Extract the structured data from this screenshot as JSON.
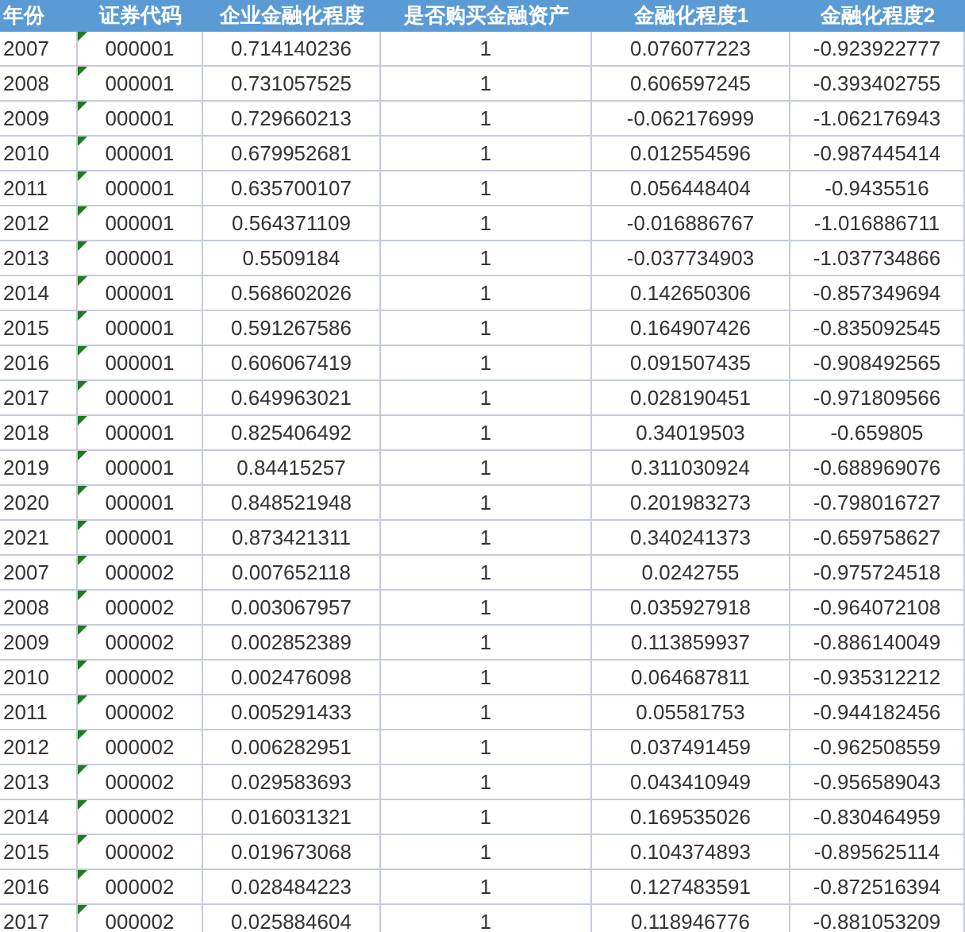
{
  "table": {
    "columns": [
      "年份",
      "证券代码",
      "企业金融化程度",
      "是否购买金融资产",
      "金融化程度1",
      "金融化程度2"
    ],
    "rows": [
      {
        "cells": [
          "2007",
          "000001",
          "0.714140236",
          "1",
          "0.076077223",
          "-0.923922777"
        ],
        "flagged": true
      },
      {
        "cells": [
          "2008",
          "000001",
          "0.731057525",
          "1",
          "0.606597245",
          "-0.393402755"
        ],
        "flagged": true
      },
      {
        "cells": [
          "2009",
          "000001",
          "0.729660213",
          "1",
          "-0.062176999",
          "-1.062176943"
        ],
        "flagged": true
      },
      {
        "cells": [
          "2010",
          "000001",
          "0.679952681",
          "1",
          "0.012554596",
          "-0.987445414"
        ],
        "flagged": true
      },
      {
        "cells": [
          "2011",
          "000001",
          "0.635700107",
          "1",
          "0.056448404",
          "-0.9435516"
        ],
        "flagged": true
      },
      {
        "cells": [
          "2012",
          "000001",
          "0.564371109",
          "1",
          "-0.016886767",
          "-1.016886711"
        ],
        "flagged": true
      },
      {
        "cells": [
          "2013",
          "000001",
          "0.5509184",
          "1",
          "-0.037734903",
          "-1.037734866"
        ],
        "flagged": true
      },
      {
        "cells": [
          "2014",
          "000001",
          "0.568602026",
          "1",
          "0.142650306",
          "-0.857349694"
        ],
        "flagged": true
      },
      {
        "cells": [
          "2015",
          "000001",
          "0.591267586",
          "1",
          "0.164907426",
          "-0.835092545"
        ],
        "flagged": true
      },
      {
        "cells": [
          "2016",
          "000001",
          "0.606067419",
          "1",
          "0.091507435",
          "-0.908492565"
        ],
        "flagged": true
      },
      {
        "cells": [
          "2017",
          "000001",
          "0.649963021",
          "1",
          "0.028190451",
          "-0.971809566"
        ],
        "flagged": true
      },
      {
        "cells": [
          "2018",
          "000001",
          "0.825406492",
          "1",
          "0.34019503",
          "-0.659805"
        ],
        "flagged": true
      },
      {
        "cells": [
          "2019",
          "000001",
          "0.84415257",
          "1",
          "0.311030924",
          "-0.688969076"
        ],
        "flagged": true
      },
      {
        "cells": [
          "2020",
          "000001",
          "0.848521948",
          "1",
          "0.201983273",
          "-0.798016727"
        ],
        "flagged": true
      },
      {
        "cells": [
          "2021",
          "000001",
          "0.873421311",
          "1",
          "0.340241373",
          "-0.659758627"
        ],
        "flagged": true
      },
      {
        "cells": [
          "2007",
          "000002",
          "0.007652118",
          "1",
          "0.0242755",
          "-0.975724518"
        ],
        "flagged": true
      },
      {
        "cells": [
          "2008",
          "000002",
          "0.003067957",
          "1",
          "0.035927918",
          "-0.964072108"
        ],
        "flagged": true
      },
      {
        "cells": [
          "2009",
          "000002",
          "0.002852389",
          "1",
          "0.113859937",
          "-0.886140049"
        ],
        "flagged": true
      },
      {
        "cells": [
          "2010",
          "000002",
          "0.002476098",
          "1",
          "0.064687811",
          "-0.935312212"
        ],
        "flagged": true
      },
      {
        "cells": [
          "2011",
          "000002",
          "0.005291433",
          "1",
          "0.05581753",
          "-0.944182456"
        ],
        "flagged": true
      },
      {
        "cells": [
          "2012",
          "000002",
          "0.006282951",
          "1",
          "0.037491459",
          "-0.962508559"
        ],
        "flagged": true
      },
      {
        "cells": [
          "2013",
          "000002",
          "0.029583693",
          "1",
          "0.043410949",
          "-0.956589043"
        ],
        "flagged": true
      },
      {
        "cells": [
          "2014",
          "000002",
          "0.016031321",
          "1",
          "0.169535026",
          "-0.830464959"
        ],
        "flagged": true
      },
      {
        "cells": [
          "2015",
          "000002",
          "0.019673068",
          "1",
          "0.104374893",
          "-0.895625114"
        ],
        "flagged": true
      },
      {
        "cells": [
          "2016",
          "000002",
          "0.028484223",
          "1",
          "0.127483591",
          "-0.872516394"
        ],
        "flagged": true
      },
      {
        "cells": [
          "2017",
          "000002",
          "0.025884604",
          "1",
          "0.118946776",
          "-0.881053209"
        ],
        "flagged": true
      }
    ]
  }
}
